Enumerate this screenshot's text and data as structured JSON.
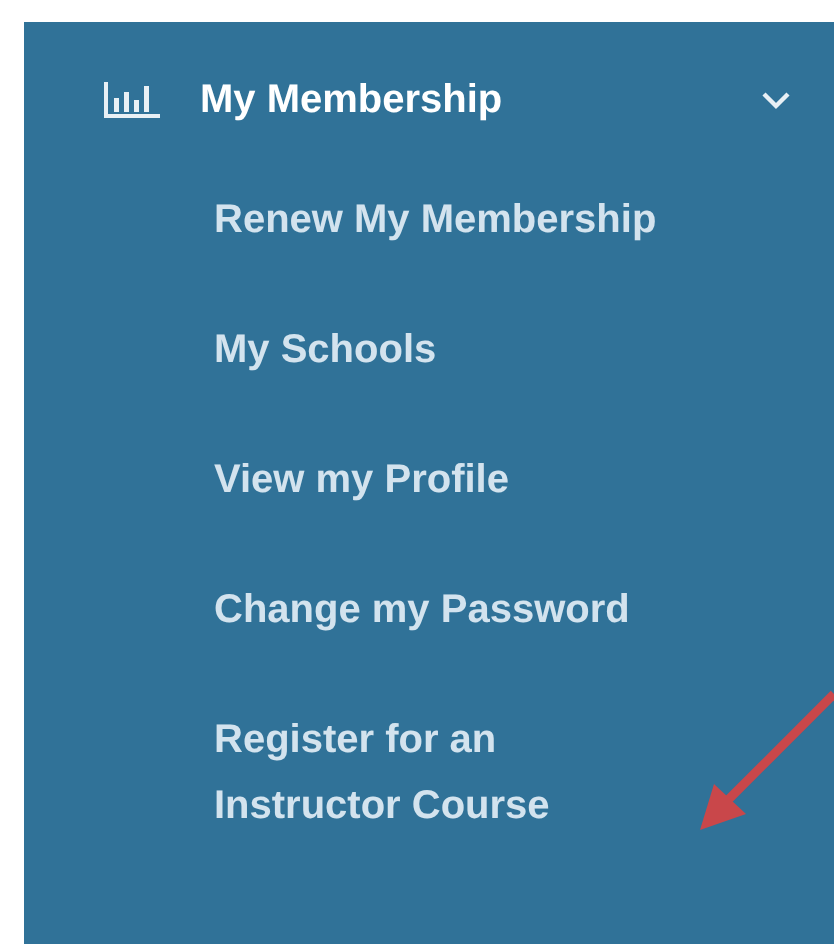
{
  "menu": {
    "title": "My Membership",
    "expanded": true,
    "items": [
      {
        "label": "Renew My Membership"
      },
      {
        "label": "My Schools"
      },
      {
        "label": "View my Profile"
      },
      {
        "label": "Change my Password"
      },
      {
        "label": "Register for an Instructor Course"
      }
    ]
  }
}
